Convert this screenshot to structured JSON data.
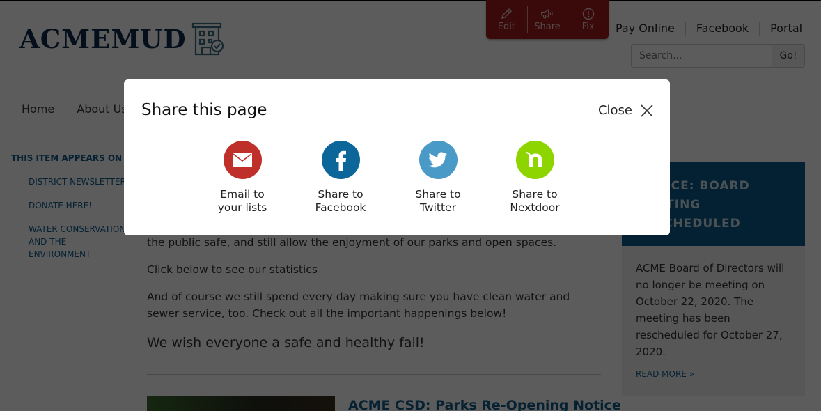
{
  "logo": {
    "text": "ACMEMUD"
  },
  "editbar": {
    "buttons": [
      {
        "label": "Edit",
        "icon": "pencil-icon"
      },
      {
        "label": "Share",
        "icon": "megaphone-icon"
      },
      {
        "label": "Fix",
        "icon": "alert-circle-icon"
      }
    ]
  },
  "utilnav": {
    "items": [
      "Pay Online",
      "Facebook",
      "Portal"
    ]
  },
  "search": {
    "placeholder": "Search...",
    "button": "Go!"
  },
  "mainnav": {
    "items": [
      "Home",
      "About Us"
    ]
  },
  "sidebar": {
    "title": "THIS ITEM APPEARS ON",
    "items": [
      "DISTRICT NEWSLETTER",
      "DONATE HERE!",
      "WATER CONSERVATION AND THE ENVIRONMENT"
    ]
  },
  "content": {
    "p1": "the public safe, and still allow the enjoyment of our parks and open spaces.",
    "p2": "Click below to see our statistics",
    "p3": "And of course we still spend every day making sure you have clean water and sewer service, too. Check out all the important happenings below!",
    "p4": "We wish everyone a safe and healthy fall!",
    "post_title": "ACME CSD: Parks Re-Opening Notice"
  },
  "notice": {
    "title": "NOTICE: BOARD MEETING RESCHEDULED",
    "body": "ACME Board of Directors will no longer be meeting on October 22, 2020. The meeting has been rescheduled for October 27, 2020.",
    "more": "READ MORE »"
  },
  "modal": {
    "title": "Share this page",
    "close": "Close",
    "options": [
      {
        "line1": "Email to",
        "line2": "your lists",
        "color": "#c0302b",
        "icon": "email-icon"
      },
      {
        "line1": "Share to",
        "line2": "Facebook",
        "color": "#0d6699",
        "icon": "facebook-icon"
      },
      {
        "line1": "Share to",
        "line2": "Twitter",
        "color": "#4a9ac8",
        "icon": "twitter-icon"
      },
      {
        "line1": "Share to",
        "line2": "Nextdoor",
        "color": "#8ed500",
        "icon": "nextdoor-icon"
      }
    ]
  }
}
